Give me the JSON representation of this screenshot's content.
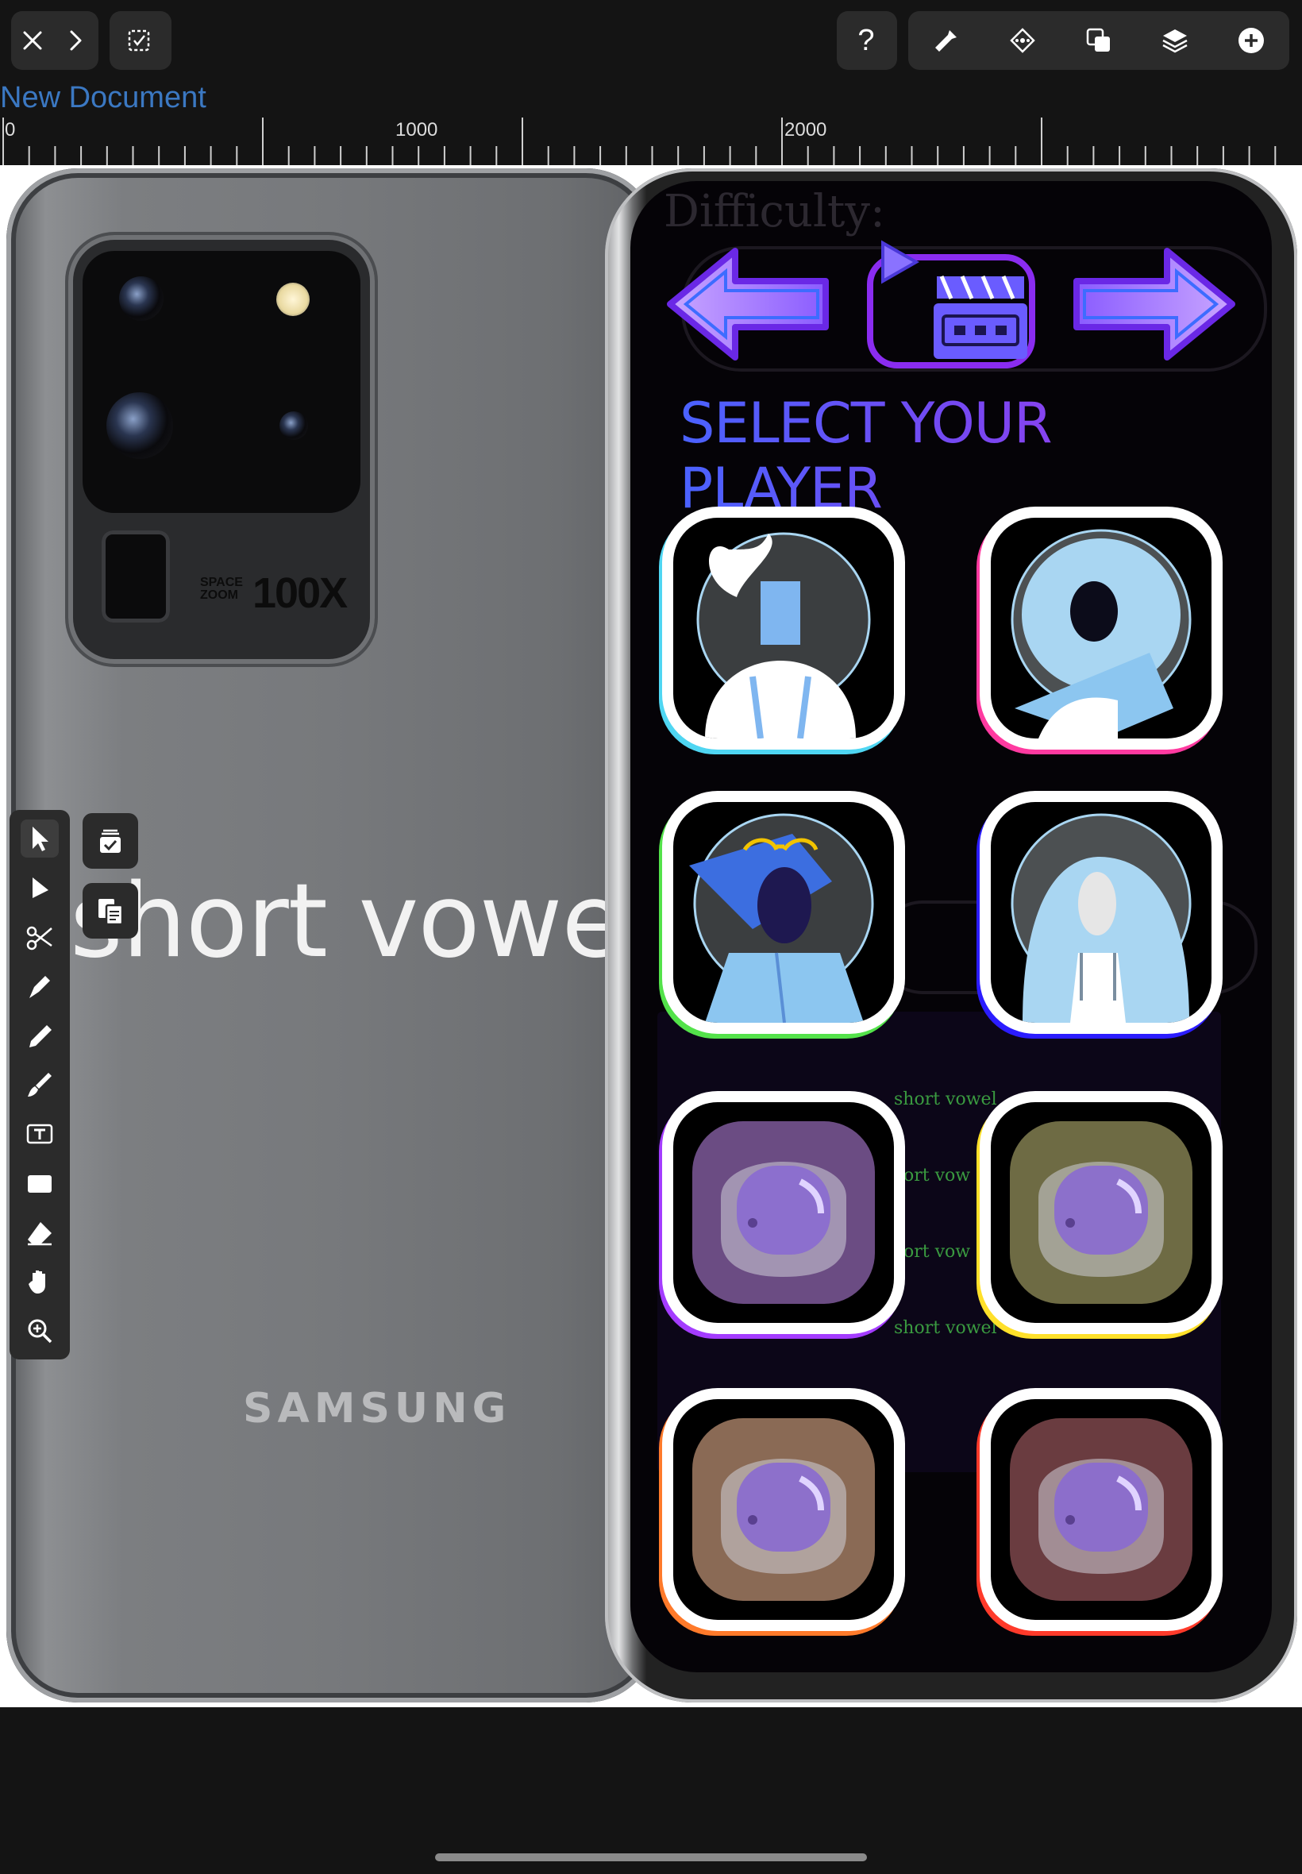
{
  "app": {
    "document_title": "New Document"
  },
  "toolbar": {
    "left": [
      "close-icon",
      "chevron-right-icon",
      "select-check-icon"
    ],
    "right": [
      "help-icon",
      "wrench-icon",
      "snapping-icon",
      "shape-combine-icon",
      "layers-icon",
      "add-icon"
    ],
    "help_label": "?"
  },
  "ruler": {
    "labels": [
      "0",
      "1000",
      "2000"
    ]
  },
  "tools": {
    "items": [
      "select-arrow-icon",
      "direct-select-icon",
      "scissors-icon",
      "pen-icon",
      "pencil-icon",
      "brush-icon",
      "text-tool-icon",
      "rectangle-icon",
      "eraser-icon",
      "hand-icon",
      "zoom-icon"
    ],
    "floating": [
      "arrange-icon",
      "duplicate-icon"
    ]
  },
  "canvas": {
    "phone_back": {
      "label_overlay": "short vowel",
      "brand": "SAMSUNG",
      "zoom_small": "SPACE ZOOM",
      "zoom_big": "100X"
    },
    "phone_screen": {
      "difficulty_label": "Difficulty:",
      "title": "SELECT YOUR PLAYER",
      "ghost_rows": [
        "short vowel",
        "ort vow",
        "ort vow",
        "short vowel"
      ],
      "players": [
        {
          "name": "player-1",
          "type": "person",
          "border": "#4fd6f2"
        },
        {
          "name": "player-2",
          "type": "person",
          "border": "#ff3aa0"
        },
        {
          "name": "player-3",
          "type": "person",
          "border": "#53e24a"
        },
        {
          "name": "player-4",
          "type": "person",
          "border": "#2b1cff"
        },
        {
          "name": "player-5",
          "type": "astronaut",
          "border": "#a43cff",
          "tint": "#6b4c83"
        },
        {
          "name": "player-6",
          "type": "astronaut",
          "border": "#ffe02a",
          "tint": "#6e6b44"
        },
        {
          "name": "player-7",
          "type": "astronaut",
          "border": "#ff7a2a",
          "tint": "#8a6a55"
        },
        {
          "name": "player-8",
          "type": "astronaut",
          "border": "#ff3a2a",
          "tint": "#6a3c40"
        }
      ]
    }
  },
  "colors": {
    "background": "#141414",
    "panel": "#2b2b2b",
    "title_link": "#3b78c2",
    "accent_purple": "#7a46f0"
  }
}
